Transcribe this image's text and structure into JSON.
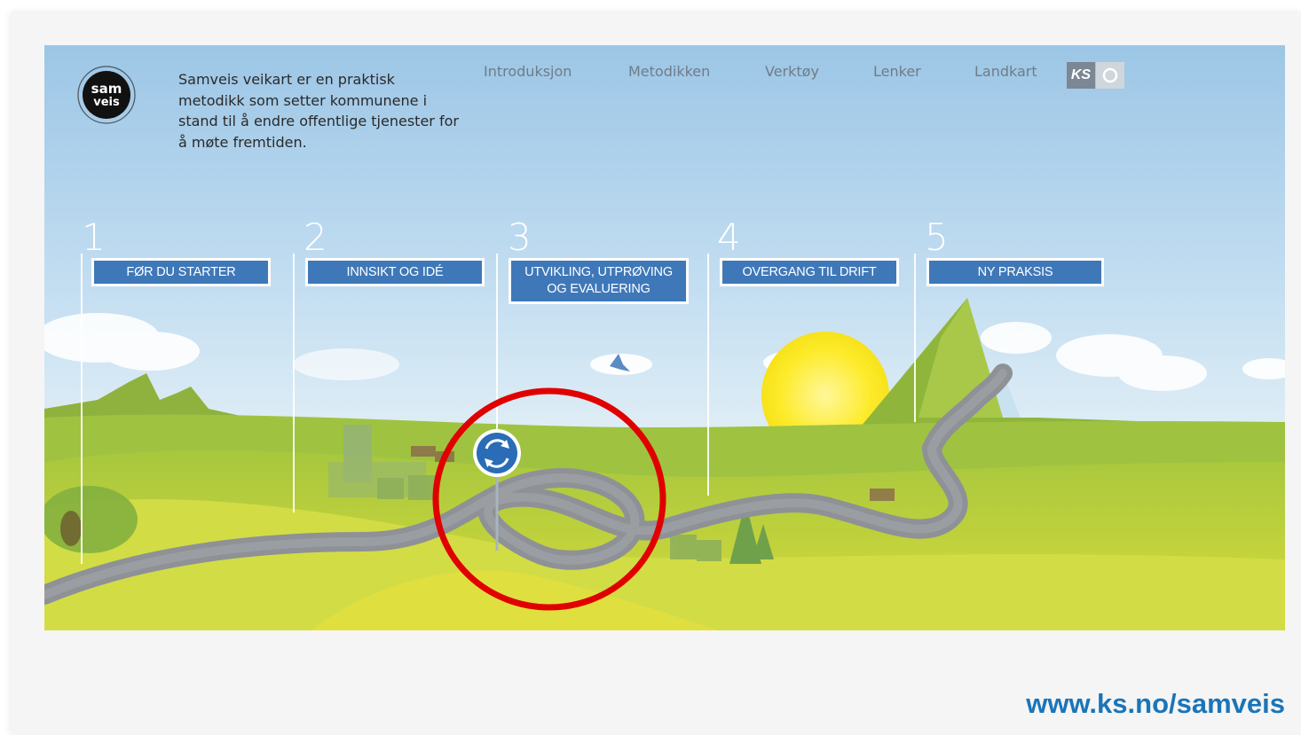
{
  "header": {
    "intro_text": "Samveis veikart er en praktisk metodikk som setter kommunene i stand til å endre offentlige tjenester for å møte fremtiden.",
    "logo_text_top": "sam",
    "logo_text_bottom": "veis",
    "nav": [
      {
        "label": "Introduksjon"
      },
      {
        "label": "Metodikken"
      },
      {
        "label": "Verktøy"
      },
      {
        "label": "Lenker"
      },
      {
        "label": "Landkart"
      }
    ],
    "ks_badge": "KS"
  },
  "steps": [
    {
      "number": "1",
      "label": "FØR DU STARTER"
    },
    {
      "number": "2",
      "label": "INNSIKT OG IDÉ"
    },
    {
      "number": "3",
      "label": "UTVIKLING, UTPRØVING OG EVALUERING"
    },
    {
      "number": "4",
      "label": "OVERGANG TIL DRIFT"
    },
    {
      "number": "5",
      "label": "NY PRAKSIS"
    }
  ],
  "footer": {
    "url": "www.ks.no/samveis"
  },
  "colors": {
    "sky_top": "#9cc6e6",
    "grass": "#c8d94a",
    "road": "#8e9196",
    "step_box": "#3f78b8",
    "highlight_circle": "#e00000",
    "url": "#1b75b8"
  }
}
